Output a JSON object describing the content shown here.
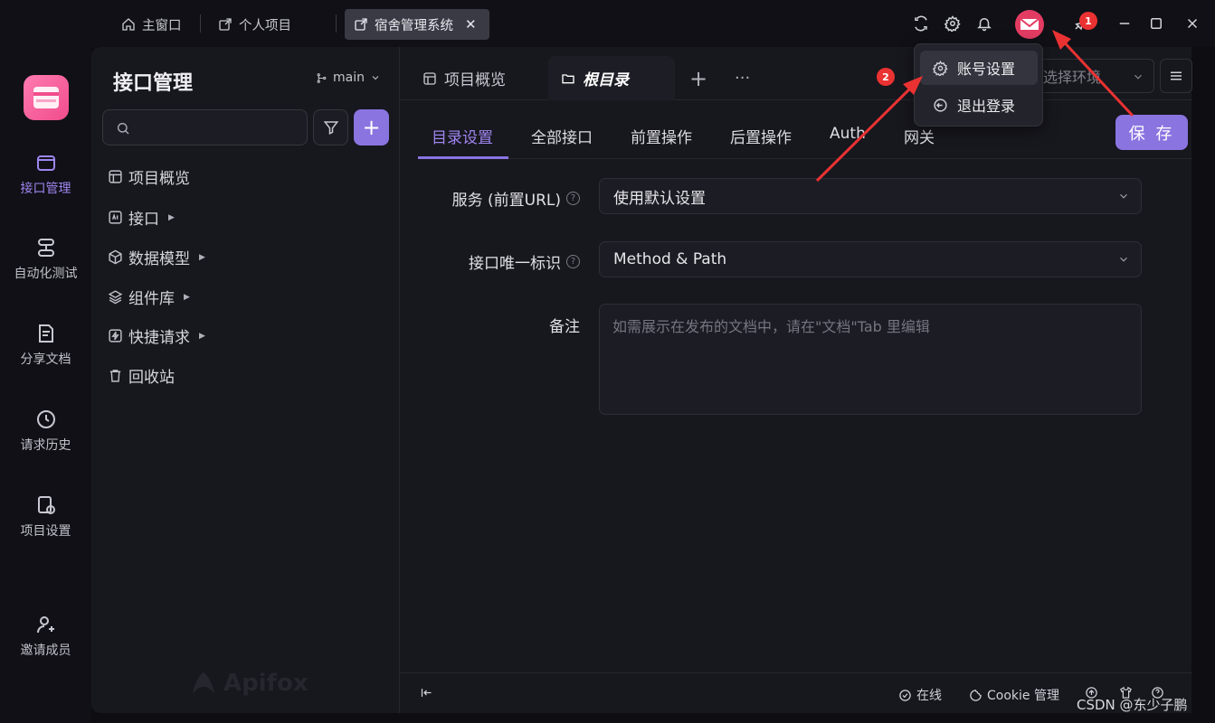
{
  "window_tabs": [
    {
      "label": "主窗口",
      "icon": "home-icon"
    },
    {
      "label": "个人项目",
      "icon": "external-link-icon"
    },
    {
      "label": "宿舍管理系统",
      "icon": "external-link-icon",
      "active": true
    }
  ],
  "badges": {
    "notify_count": "1",
    "menu_step": "2"
  },
  "account_menu": {
    "settings": "账号设置",
    "logout": "退出登录"
  },
  "rail": [
    {
      "label": "接口管理",
      "active": true
    },
    {
      "label": "自动化测试"
    },
    {
      "label": "分享文档"
    },
    {
      "label": "请求历史"
    },
    {
      "label": "项目设置"
    },
    {
      "label": "邀请成员"
    }
  ],
  "sidebar": {
    "title": "接口管理",
    "branch": "main",
    "search_placeholder": "",
    "tree": [
      "项目概览",
      "接口",
      "数据模型",
      "组件库",
      "快捷请求",
      "回收站"
    ],
    "watermark": "Apifox"
  },
  "tabs": {
    "overview": "项目概览",
    "root": "根目录",
    "add": "+",
    "more": "···"
  },
  "env": {
    "placeholder": "选择环境"
  },
  "subtabs": [
    "目录设置",
    "全部接口",
    "前置操作",
    "后置操作",
    "Auth",
    "网关"
  ],
  "save_label": "保 存",
  "form": {
    "service_label": "服务 (前置URL)",
    "service_value": "使用默认设置",
    "id_label": "接口唯一标识",
    "id_value": "Method & Path",
    "note_label": "备注",
    "note_placeholder": "如需展示在发布的文档中，请在\"文档\"Tab 里编辑"
  },
  "footer": {
    "online": "在线",
    "cookie": "Cookie 管理"
  },
  "watermark_csdn": "CSDN @东少子鹏",
  "colors": {
    "accent": "#8a74e0",
    "bg": "#17171e",
    "badge": "#ea3232"
  }
}
